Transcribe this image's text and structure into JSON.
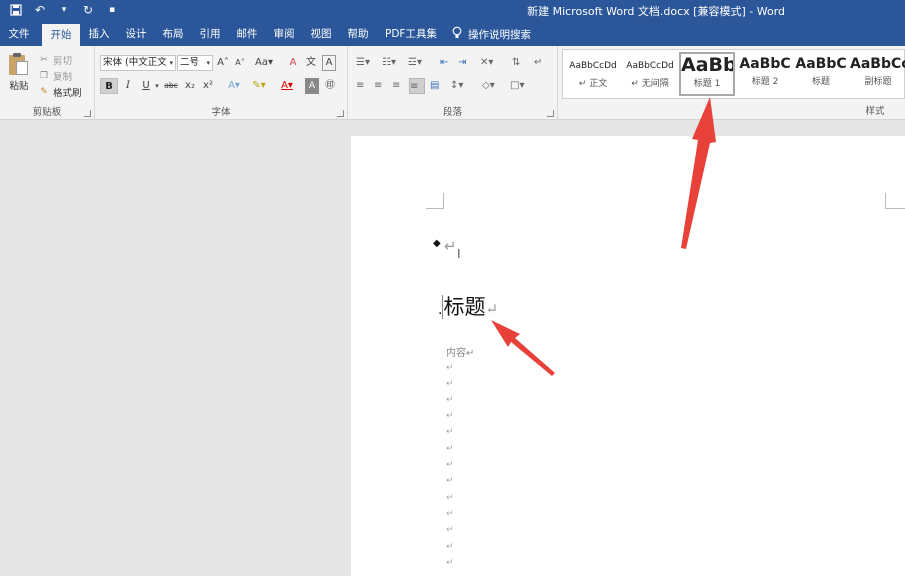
{
  "window": {
    "title": "新建 Microsoft Word 文档.docx [兼容模式]  -  Word"
  },
  "tabs": [
    {
      "label": "文件",
      "active": false
    },
    {
      "label": "开始",
      "active": true
    },
    {
      "label": "插入",
      "active": false
    },
    {
      "label": "设计",
      "active": false
    },
    {
      "label": "布局",
      "active": false
    },
    {
      "label": "引用",
      "active": false
    },
    {
      "label": "邮件",
      "active": false
    },
    {
      "label": "审阅",
      "active": false
    },
    {
      "label": "视图",
      "active": false
    },
    {
      "label": "帮助",
      "active": false
    },
    {
      "label": "PDF工具集",
      "active": false
    }
  ],
  "tell_me": "操作说明搜索",
  "clipboard": {
    "paste": "粘贴",
    "cut": "剪切",
    "copy": "复制",
    "format_painter": "格式刷",
    "group_label": "剪贴板"
  },
  "font": {
    "font_name": "宋体 (中文正文",
    "font_size": "二号",
    "group_label": "字体",
    "change_case": "Aa",
    "bold": "B",
    "italic": "I",
    "underline": "U",
    "strike": "abc",
    "subscript": "x₂",
    "superscript": "x²"
  },
  "paragraph": {
    "group_label": "段落"
  },
  "styles": {
    "group_label": "样式",
    "items": [
      {
        "preview": "AaBbCcDd",
        "name": "↵ 正文",
        "selected": false
      },
      {
        "preview": "AaBbCcDd",
        "name": "↵ 无间隔",
        "selected": false
      },
      {
        "preview": "AaBb",
        "name": "标题 1",
        "selected": true
      },
      {
        "preview": "AaBbC",
        "name": "标题 2",
        "selected": false
      },
      {
        "preview": "AaBbC",
        "name": "标题",
        "selected": false
      },
      {
        "preview": "AaBbCc",
        "name": "副标题",
        "selected": false
      }
    ]
  },
  "document": {
    "heading": "标题",
    "content": "内容",
    "return_mark": "↵"
  },
  "colors": {
    "accent": "#2b579a",
    "annotation": "#e8413a"
  }
}
